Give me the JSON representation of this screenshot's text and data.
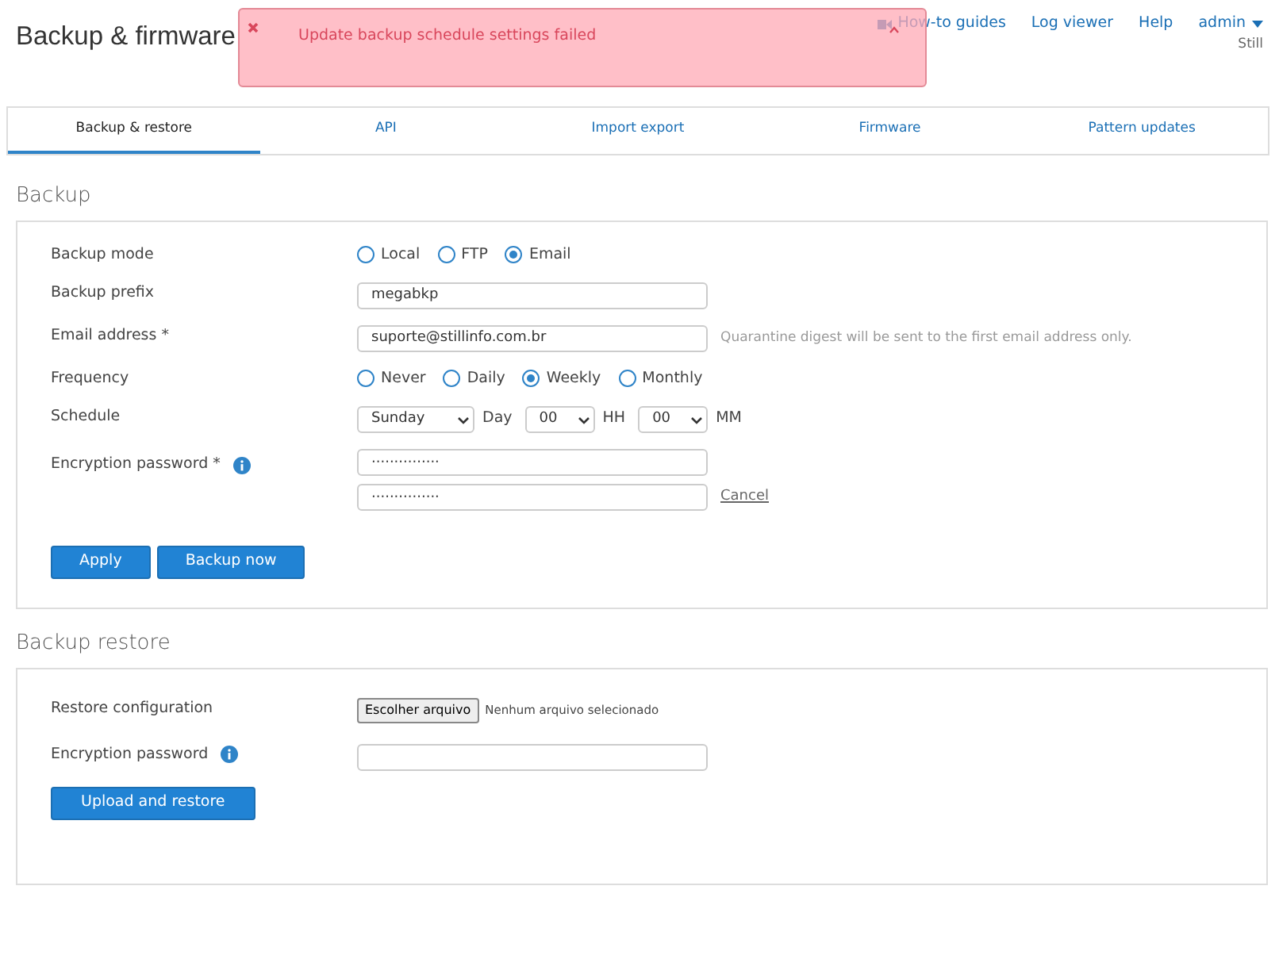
{
  "header": {
    "title": "Backup & firmware",
    "links": [
      {
        "label": "How-to guides",
        "kind": "video"
      },
      {
        "label": "Log viewer",
        "kind": "plain"
      },
      {
        "label": "Help",
        "kind": "plain"
      }
    ],
    "user": "admin",
    "organization": "Still"
  },
  "alert": {
    "message": "Update backup schedule settings failed"
  },
  "tabs": [
    {
      "label": "Backup & restore",
      "selected": true
    },
    {
      "label": "API",
      "selected": false
    },
    {
      "label": "Import export",
      "selected": false
    },
    {
      "label": "Firmware",
      "selected": false
    },
    {
      "label": "Pattern updates",
      "selected": false
    }
  ],
  "sections": [
    {
      "title": "Backup",
      "rows": [
        {
          "kind": "radio",
          "label": "Backup mode",
          "options": [
            {
              "label": "Local",
              "selected": false
            },
            {
              "label": "FTP",
              "selected": false
            },
            {
              "label": "Email",
              "selected": true
            }
          ]
        },
        {
          "kind": "text",
          "label": "Backup prefix",
          "value": "megabkp"
        },
        {
          "kind": "text",
          "label": "Email address *",
          "value": "suporte@stillinfo.com.br",
          "hint": "Quarantine digest will be sent to the first email address only."
        },
        {
          "kind": "radio",
          "label": "Frequency",
          "options": [
            {
              "label": "Never",
              "selected": false
            },
            {
              "label": "Daily",
              "selected": false
            },
            {
              "label": "Weekly",
              "selected": true
            },
            {
              "label": "Monthly",
              "selected": false
            }
          ]
        },
        {
          "kind": "schedule",
          "label": "Schedule",
          "selects": [
            {
              "value": "Sunday",
              "unit": "Day"
            },
            {
              "value": "00",
              "unit": "HH"
            },
            {
              "value": "00",
              "unit": "MM"
            }
          ]
        },
        {
          "kind": "password",
          "label": "Encryption password *",
          "info": true,
          "values": [
            "···············",
            "···············"
          ],
          "cancel": "Cancel"
        }
      ],
      "buttons": [
        "Apply",
        "Backup now"
      ]
    },
    {
      "title": "Backup restore",
      "rows": [
        {
          "kind": "file",
          "label": "Restore configuration",
          "button": "Escolher arquivo",
          "status": "Nenhum arquivo selecionado"
        },
        {
          "kind": "password",
          "label": "Encryption password",
          "info": true
        }
      ],
      "buttons": [
        "Upload and restore"
      ]
    }
  ]
}
